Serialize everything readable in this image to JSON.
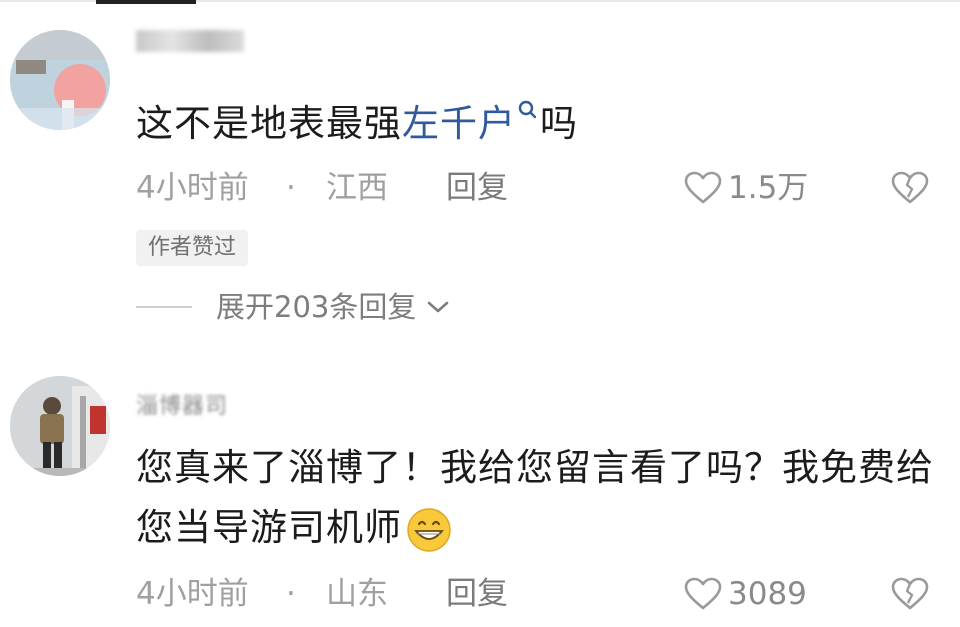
{
  "comments": [
    {
      "text_before": "这不是地表最强",
      "link": "左千户",
      "text_after": "吗",
      "time": "4小时前",
      "dot": "·",
      "location": "江西",
      "reply_label": "回复",
      "likes": "1.5万",
      "badge": "作者赞过",
      "expand_label": "展开203条回复"
    },
    {
      "username_partial": "淄博器司",
      "text_before": "您真来了淄博了！我给您留言看了吗？我免费给您当导游司机师",
      "time": "4小时前",
      "dot": "·",
      "location": "山东",
      "reply_label": "回复",
      "likes": "3089"
    }
  ],
  "icons": {
    "like": "heart-outline-icon",
    "dislike": "broken-heart-icon",
    "search": "search-icon",
    "chevron": "chevron-down-icon",
    "emoji": "grinning-face-icon"
  },
  "colors": {
    "link": "#2f5a9c",
    "text": "#1c1c1c",
    "meta": "#a0a0a0"
  }
}
